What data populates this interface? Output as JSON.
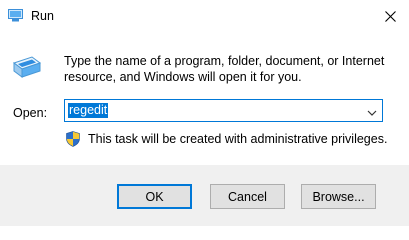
{
  "window": {
    "title": "Run",
    "accent_color": "#0078d7"
  },
  "icons": {
    "app": "run-icon",
    "close": "close-icon",
    "dropdown": "chevron-down-icon",
    "uac": "shield-icon"
  },
  "dialog": {
    "description_line1": "Type the name of a program, folder, document, or Internet",
    "description_line2": "resource, and Windows will open it for you.",
    "open_label": "Open:",
    "open_value": "regedit",
    "admin_note": "This task will be created with administrative privileges."
  },
  "buttons": {
    "ok": "OK",
    "cancel": "Cancel",
    "browse": "Browse..."
  }
}
